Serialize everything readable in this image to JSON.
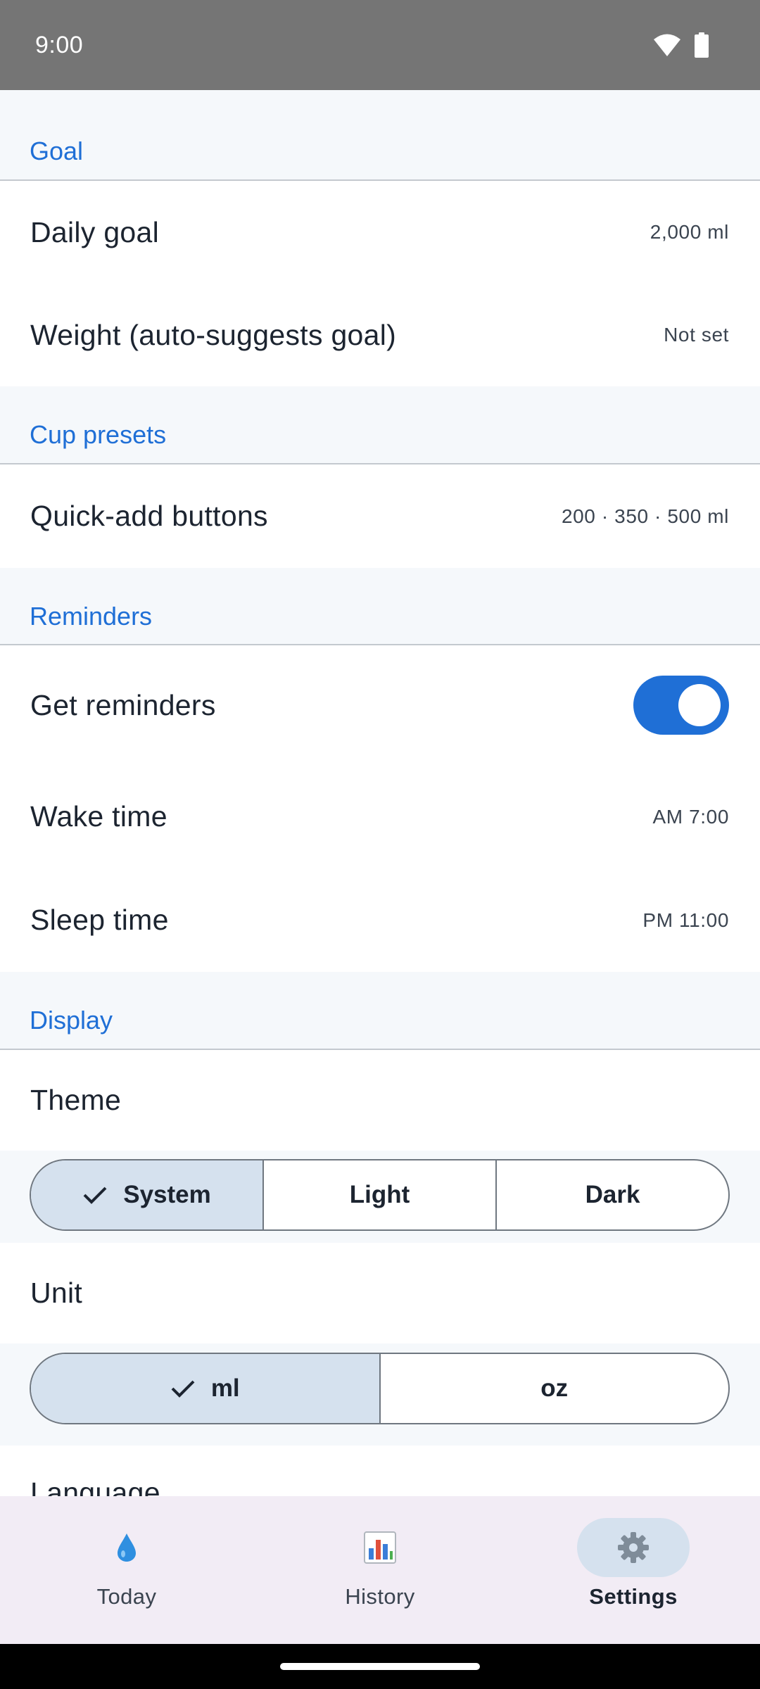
{
  "status_bar": {
    "time": "9:00"
  },
  "sections": {
    "goal": {
      "header": "Goal",
      "daily_goal": {
        "label": "Daily goal",
        "value": "2,000 ml"
      },
      "weight": {
        "label": "Weight (auto-suggests goal)",
        "value": "Not set"
      }
    },
    "cup_presets": {
      "header": "Cup presets",
      "quick_add": {
        "label": "Quick-add buttons",
        "value": "200 · 350 · 500 ml"
      }
    },
    "reminders": {
      "header": "Reminders",
      "get_reminders": {
        "label": "Get reminders",
        "enabled": true
      },
      "wake_time": {
        "label": "Wake time",
        "value": "AM 7:00"
      },
      "sleep_time": {
        "label": "Sleep time",
        "value": "PM 11:00"
      }
    },
    "display": {
      "header": "Display",
      "theme": {
        "label": "Theme",
        "options": [
          "System",
          "Light",
          "Dark"
        ],
        "selected": "System"
      },
      "unit": {
        "label": "Unit",
        "options": [
          "ml",
          "oz"
        ],
        "selected": "ml"
      },
      "language": {
        "label": "Language"
      }
    }
  },
  "bottom_nav": {
    "items": [
      {
        "label": "Today",
        "icon": "water-drop-icon",
        "active": false
      },
      {
        "label": "History",
        "icon": "bar-chart-icon",
        "active": false
      },
      {
        "label": "Settings",
        "icon": "gear-icon",
        "active": true
      }
    ]
  },
  "colors": {
    "accent": "#1f6fd6",
    "selected_bg": "#d5e1ee",
    "nav_bg": "#f2ecf5",
    "status_bar": "#757575"
  }
}
